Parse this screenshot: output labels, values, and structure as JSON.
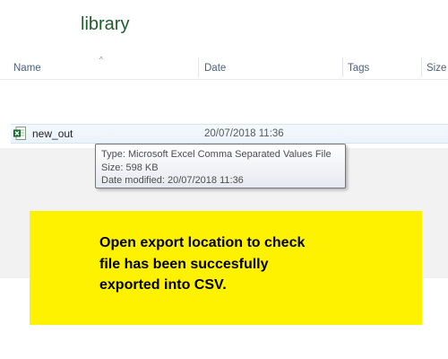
{
  "window": {
    "library_title": "library"
  },
  "columns": {
    "name": "Name",
    "date": "Date",
    "tags": "Tags",
    "size": "Size",
    "sort_indicator": "^"
  },
  "files": [
    {
      "icon": "excel-csv-icon",
      "name": "new_out",
      "date": "20/07/2018 11:36"
    }
  ],
  "tooltip": {
    "type_line": "Type: Microsoft Excel Comma Separated Values File",
    "size_line": "Size: 598 KB",
    "date_line": "Date modified: 20/07/2018 11:36"
  },
  "callout": {
    "line1": "Open export location to check",
    "line2": "file has been succesfully",
    "line3": "exported into CSV."
  },
  "colors": {
    "callout_background": "#fff200",
    "title_green": "#1e5d2c",
    "header_text": "#4c607a",
    "selection": "#eaf2fa"
  }
}
